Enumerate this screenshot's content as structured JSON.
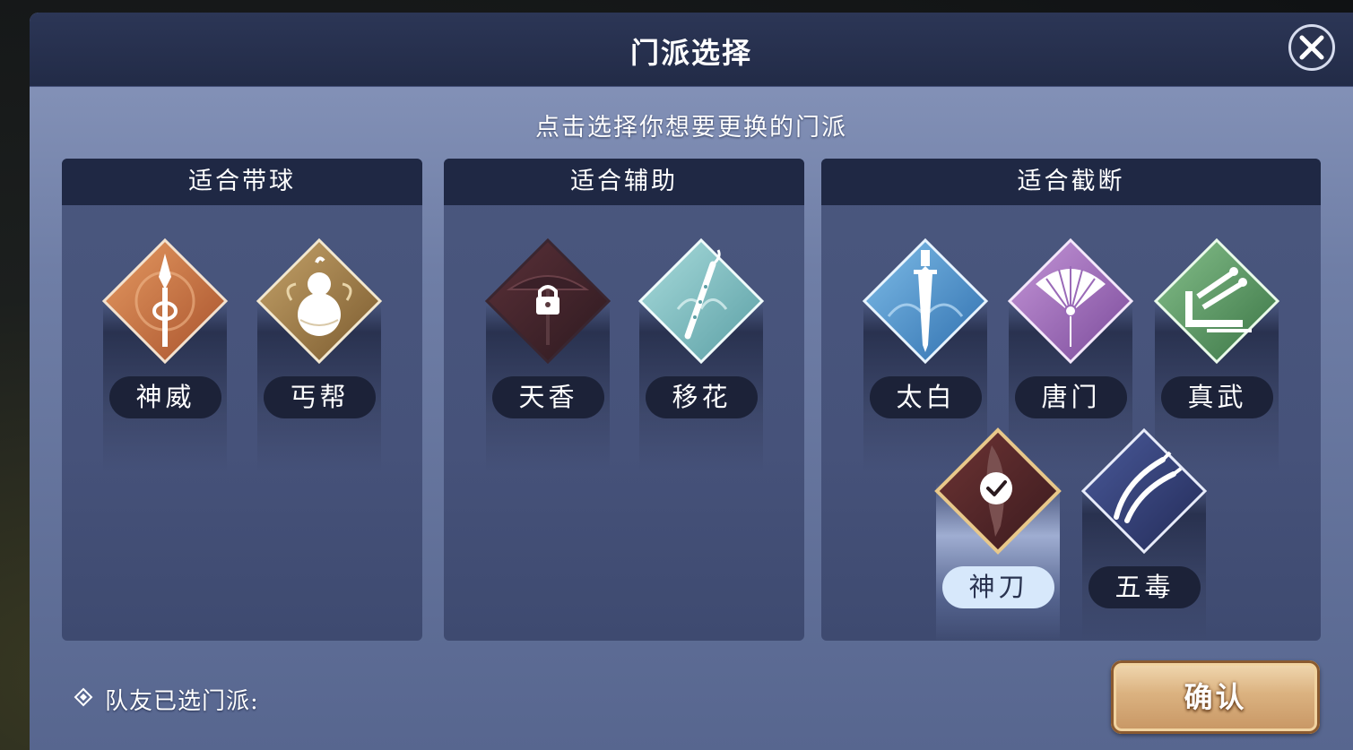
{
  "dialog": {
    "title": "门派选择",
    "subtitle": "点击选择你想要更换的门派",
    "teammates_label": "队友已选门派:",
    "confirm_label": "确认"
  },
  "groups": [
    {
      "title": "适合带球",
      "sects": [
        {
          "name": "神威",
          "icon": "spear-icon",
          "color": "#c8703f",
          "locked": false,
          "selected": false
        },
        {
          "name": "丐帮",
          "icon": "gourd-icon",
          "color": "#9b7a45",
          "locked": false,
          "selected": false
        }
      ]
    },
    {
      "title": "适合辅助",
      "sects": [
        {
          "name": "天香",
          "icon": "umbrella-icon",
          "color": "#4a2a30",
          "locked": true,
          "selected": false
        },
        {
          "name": "移花",
          "icon": "flute-icon",
          "color": "#7fbcc0",
          "locked": false,
          "selected": false
        }
      ]
    },
    {
      "title": "适合截断",
      "sects": [
        {
          "name": "太白",
          "icon": "sword-icon",
          "color": "#4c8ec9",
          "locked": false,
          "selected": false
        },
        {
          "name": "唐门",
          "icon": "fan-icon",
          "color": "#9a6ab8",
          "locked": false,
          "selected": false
        },
        {
          "name": "真武",
          "icon": "swords-icon",
          "color": "#4c8a55",
          "locked": false,
          "selected": false
        },
        {
          "name": "神刀",
          "icon": "blade-icon",
          "color": "#5a2a2a",
          "locked": false,
          "selected": true
        },
        {
          "name": "五毒",
          "icon": "hooks-icon",
          "color": "#34407a",
          "locked": false,
          "selected": false
        }
      ]
    }
  ]
}
